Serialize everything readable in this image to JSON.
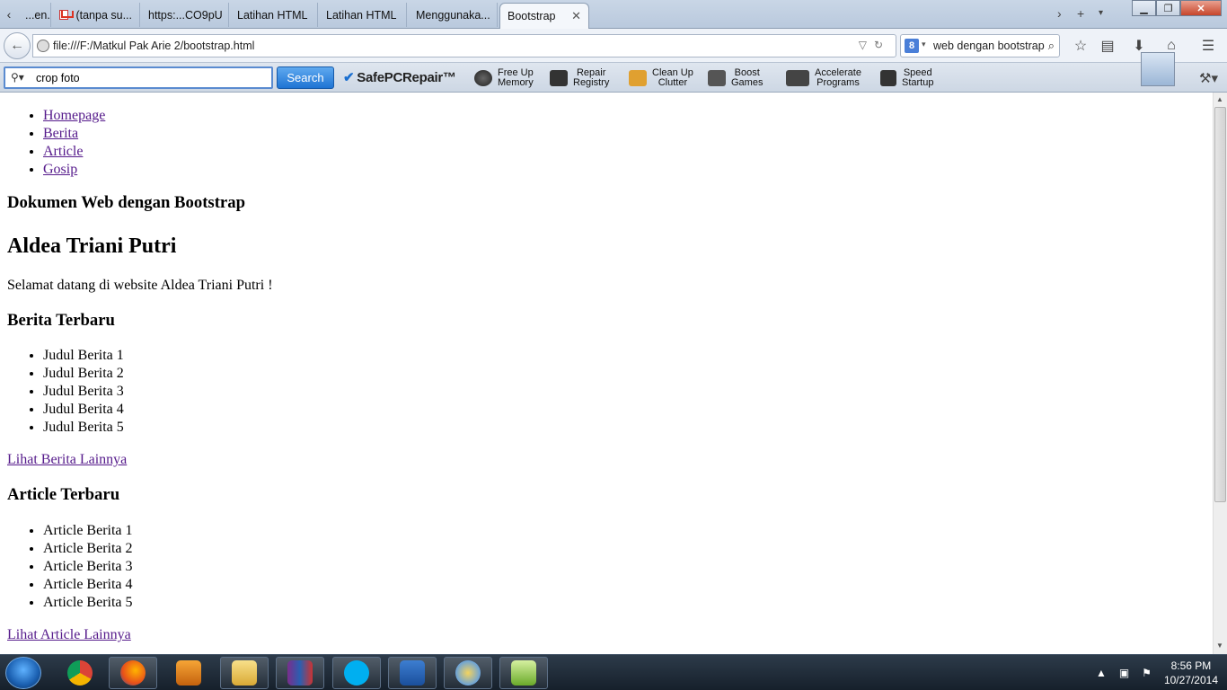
{
  "tabs": [
    {
      "label": "...en..."
    },
    {
      "label": "(tanpa su..."
    },
    {
      "label": "https:...CO9pU"
    },
    {
      "label": "Latihan HTML"
    },
    {
      "label": "Latihan HTML"
    },
    {
      "label": "Menggunaka..."
    },
    {
      "label": "Bootstrap",
      "active": true
    }
  ],
  "nav": {
    "url": "file:///F:/Matkul Pak Arie 2/bootstrap.html",
    "search_value": "web dengan bootstrap",
    "search_engine_badge": "8"
  },
  "toolbar": {
    "search_value": "crop foto",
    "search_button": "Search",
    "brand": "SafePCRepair™",
    "tools": [
      {
        "line1": "Free Up",
        "line2": "Memory"
      },
      {
        "line1": "Repair",
        "line2": "Registry"
      },
      {
        "line1": "Clean Up",
        "line2": "Clutter"
      },
      {
        "line1": "Boost",
        "line2": "Games"
      },
      {
        "line1": "Accelerate",
        "line2": "Programs"
      },
      {
        "line1": "Speed",
        "line2": "Startup"
      }
    ]
  },
  "page": {
    "nav_links": [
      "Homepage",
      "Berita",
      "Article",
      "Gosip"
    ],
    "doc_heading": "Dokumen Web dengan Bootstrap",
    "name_heading": "Aldea Triani Putri",
    "welcome": "Selamat datang di website Aldea Triani Putri !",
    "berita_heading": "Berita Terbaru",
    "berita_items": [
      "Judul Berita 1",
      "Judul Berita 2",
      "Judul Berita 3",
      "Judul Berita 4",
      "Judul Berita 5"
    ],
    "berita_more": "Lihat Berita Lainnya",
    "article_heading": "Article Terbaru",
    "article_items": [
      "Article Berita 1",
      "Article Berita 2",
      "Article Berita 3",
      "Article Berita 4",
      "Article Berita 5"
    ],
    "article_more": "Lihat Article Lainnya"
  },
  "taskbar": {
    "apps": [
      "chrome-icon",
      "firefox-icon",
      "media-player-icon",
      "file-explorer-icon",
      "winrar-icon",
      "skype-icon",
      "word-icon",
      "paint-icon",
      "notepad-icon"
    ],
    "time": "8:56 PM",
    "date": "10/27/2014"
  },
  "colors": {
    "link_visited": "#551a8b",
    "search_button": "#1f74d4",
    "taskbar": "#16202b"
  }
}
